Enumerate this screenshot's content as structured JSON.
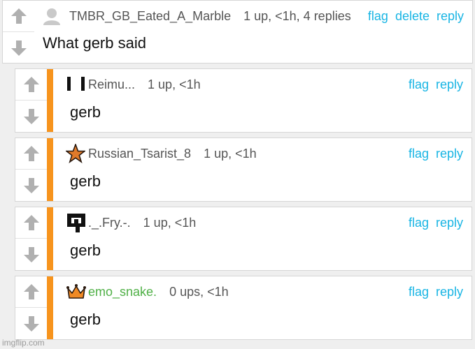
{
  "colors": {
    "accent": "#19b5e4",
    "thread_bar": "#f7941d",
    "mod_name": "#4fb046"
  },
  "icons": {
    "upvote": "up-arrow-icon",
    "downvote": "down-arrow-icon"
  },
  "parent": {
    "username": "TMBR_GB_Eated_A_Marble",
    "meta": "1 up, <1h, 4 replies",
    "actions": [
      "flag",
      "delete",
      "reply"
    ],
    "text": "What gerb said"
  },
  "replies": [
    {
      "username": "Reimu...",
      "meta": "1 up, <1h",
      "actions": [
        "flag",
        "reply"
      ],
      "text": "gerb",
      "avatar": "pixel-bars-avatar"
    },
    {
      "username": "Russian_Tsarist_8",
      "meta": "1 up, <1h",
      "actions": [
        "flag",
        "reply"
      ],
      "text": "gerb",
      "avatar": "star-avatar"
    },
    {
      "username": "._.Fry.-.",
      "meta": "1 up, <1h",
      "actions": [
        "flag",
        "reply"
      ],
      "text": "gerb",
      "avatar": "pixel-face-avatar"
    },
    {
      "username": "emo_snake.",
      "meta": "0 ups, <1h",
      "actions": [
        "flag",
        "reply"
      ],
      "text": "gerb",
      "avatar": "crown-avatar"
    }
  ],
  "watermark": "imgflip.com"
}
